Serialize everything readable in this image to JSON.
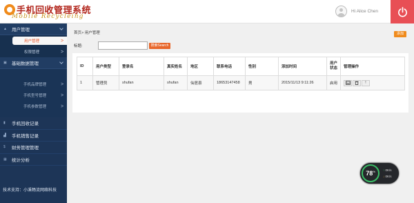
{
  "brand": {
    "title_cn": "手机回收管理系统",
    "title_en": "Mobile Recycleing"
  },
  "header": {
    "greeting": "Hi Alice Chen",
    "icons": {
      "avatar": "user-avatar-icon",
      "power": "power-icon"
    },
    "power_color": "#e84f55"
  },
  "sidebar": {
    "groups": [
      {
        "icon": "home-icon",
        "label": "用户管理",
        "items": [
          {
            "label": "用户管理",
            "arrow": ">",
            "active": true
          },
          {
            "label": "权限管理",
            "arrow": ">"
          }
        ]
      },
      {
        "icon": "folder-icon",
        "label": "基础数据管理",
        "items": [
          {
            "label": "手机品牌管理",
            "arrow": ">"
          },
          {
            "label": "手机型号管理",
            "arrow": ">"
          },
          {
            "label": "手机参数管理",
            "arrow": ">"
          }
        ]
      }
    ],
    "items": [
      {
        "icon": "phone-icon",
        "label": "手机回收记录"
      },
      {
        "icon": "bar-chart-icon",
        "label": "手机销售记录"
      },
      {
        "icon": "dollar-icon",
        "label": "财务管理管理"
      },
      {
        "icon": "table-icon",
        "label": "统计分析"
      }
    ],
    "support": "技术支持：小溪畅流网络科技",
    "bg_color": "#1d3557",
    "active_color": "#e8592d"
  },
  "main": {
    "breadcrumb": "首页> 用户管理",
    "add_button": "添加",
    "filter": {
      "label": "标题:",
      "value": "",
      "search_button": "搜索Search"
    },
    "table": {
      "columns": [
        "ID",
        "用户类型",
        "登录名",
        "真实姓名",
        "地区",
        "联系电话",
        "性别",
        "添加时间",
        "用户状态",
        "管理操作"
      ],
      "rows": [
        [
          "1",
          "管理员",
          "shufan",
          "shufan",
          "仙居县",
          "18653147458",
          "男",
          "2015/11/13 9:11:26",
          "启用",
          ""
        ]
      ]
    },
    "row_actions": [
      "inbox-icon",
      "trash-icon",
      "exclamation-icon"
    ],
    "accent_color": "#f08b1c"
  },
  "monitor": {
    "value": "78",
    "unit": "%",
    "stat_up": "0K/s",
    "stat_down": "0K/s",
    "ring_color": "#3bbd66"
  }
}
